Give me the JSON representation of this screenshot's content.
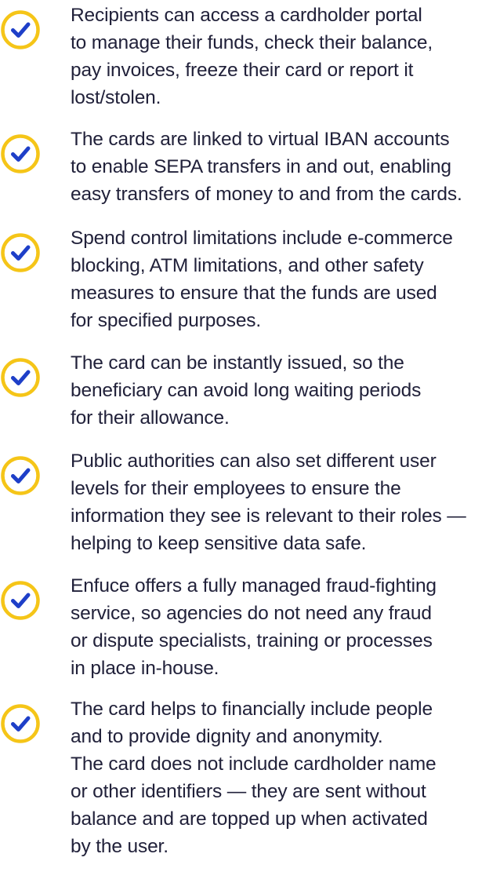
{
  "colors": {
    "check_ring": "#F5C518",
    "check_mark": "#1E3FC8",
    "text": "#21213A",
    "background": "#FFFFFF"
  },
  "icon": "check-circle-icon",
  "items": [
    {
      "lines": [
        "Recipients can access a cardholder portal",
        "to manage their funds, check their balance,",
        "pay invoices, freeze their card or report it",
        "lost/stolen."
      ]
    },
    {
      "lines": [
        "The cards are linked to virtual IBAN accounts",
        "to enable SEPA transfers in and out, enabling",
        "easy transfers of money to and from the cards."
      ]
    },
    {
      "lines": [
        "Spend control limitations include e-commerce",
        "blocking, ATM limitations, and other safety",
        "measures to ensure that the funds are used",
        "for specified purposes."
      ]
    },
    {
      "lines": [
        "The card can be instantly issued, so the",
        "beneficiary can avoid long waiting periods",
        "for their allowance."
      ]
    },
    {
      "lines": [
        "Public authorities can also set different user",
        "levels for their employees to ensure the",
        "information they see is relevant to their roles —",
        "helping to keep sensitive data safe."
      ]
    },
    {
      "lines": [
        "Enfuce offers a fully managed fraud-fighting",
        "service, so agencies do not need any fraud",
        "or dispute specialists, training or processes",
        "in place in-house."
      ]
    },
    {
      "lines": [
        "The card helps to financially include people",
        "and to provide dignity and anonymity.",
        "The card does not include cardholder name",
        "or other identifiers — they are sent without",
        "balance and are topped up when activated",
        "by the user."
      ]
    }
  ]
}
